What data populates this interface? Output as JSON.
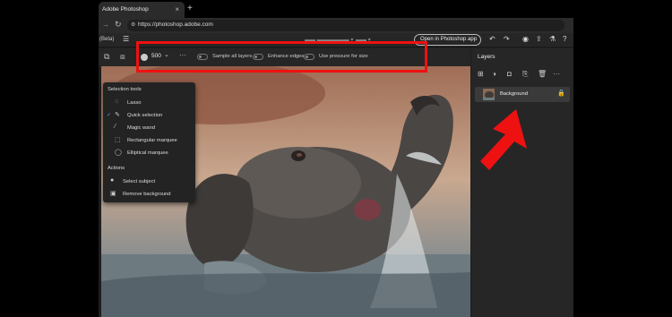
{
  "browser": {
    "tab_title": "Adobe Photoshop",
    "tab_close": "×",
    "new_tab": "+",
    "url": "https://photoshop.adobe.com"
  },
  "appbar": {
    "beta": "(Beta)",
    "open_in_app": "Open in Photoshop app"
  },
  "options_bar": {
    "brush_size": "500",
    "sample_all_layers": "Sample all layers",
    "enhance_edges": "Enhance edges",
    "use_pressure": "Use pressure for size"
  },
  "flyout": {
    "selection_header": "Selection tools",
    "tools": [
      {
        "label": "Lasso",
        "icon": "lasso-icon",
        "checked": false
      },
      {
        "label": "Quick selection",
        "icon": "quick-selection-icon",
        "checked": true
      },
      {
        "label": "Magic wand",
        "icon": "magic-wand-icon",
        "checked": false
      },
      {
        "label": "Rectangular marquee",
        "icon": "rectangle-marquee-icon",
        "checked": false
      },
      {
        "label": "Elliptical marquee",
        "icon": "ellipse-marquee-icon",
        "checked": false
      }
    ],
    "actions_header": "Actions",
    "actions": [
      {
        "label": "Select subject",
        "icon": "person-icon"
      },
      {
        "label": "Remove background",
        "icon": "image-icon"
      }
    ]
  },
  "layers_panel": {
    "title": "Layers",
    "layers": [
      {
        "name": "Background",
        "locked": true
      }
    ]
  },
  "colors": {
    "highlight": "#ee1111",
    "accent": "#4b9cf5",
    "selected_layer": "#3a3a3a"
  }
}
